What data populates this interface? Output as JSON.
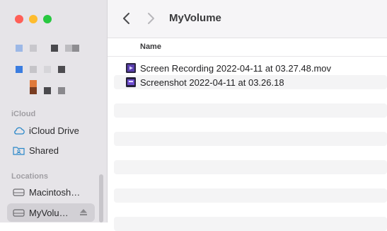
{
  "window": {
    "title": "MyVolume"
  },
  "colors": {
    "accent": "#2b7cd9",
    "sidebar_bg": "#e6e4e8",
    "stripe": "#f4f4f5"
  },
  "sidebar": {
    "icloud_title": "iCloud",
    "icloud_items": [
      {
        "label": "iCloud Drive",
        "icon": "cloud-icon"
      },
      {
        "label": "Shared",
        "icon": "shared-folder-icon"
      }
    ],
    "locations_title": "Locations",
    "location_items": [
      {
        "label": "Macintosh…",
        "icon": "drive-icon"
      },
      {
        "label": "MyVolu…",
        "icon": "drive-icon",
        "selected": true
      }
    ]
  },
  "list": {
    "column_name": "Name",
    "files": [
      {
        "name": "Screen Recording 2022-04-11 at 03.27.48.mov",
        "icon": "video-file-icon"
      },
      {
        "name": "Screenshot 2022-04-11 at 03.26.18",
        "icon": "image-file-icon"
      }
    ]
  }
}
